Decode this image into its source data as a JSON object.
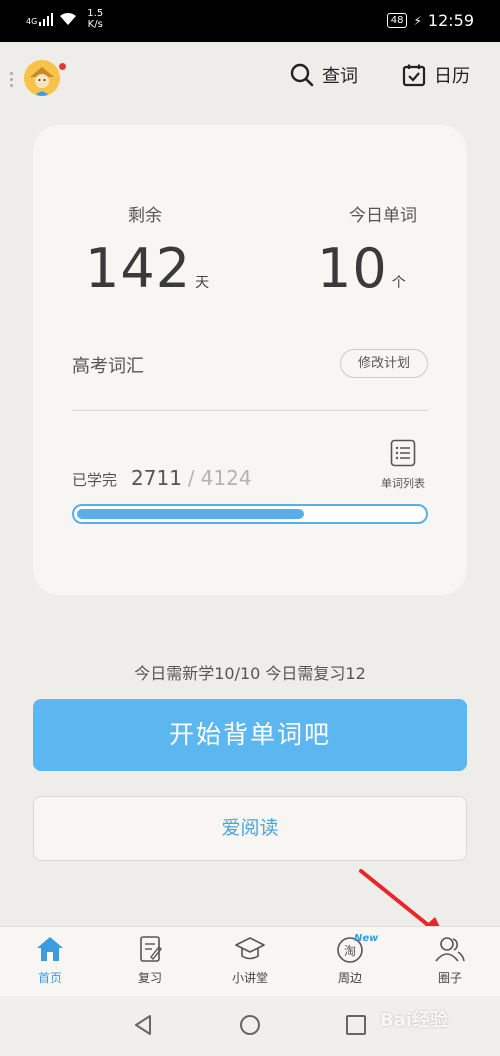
{
  "status_bar": {
    "network": "4G",
    "speed_value": "1.5",
    "speed_unit": "K/s",
    "battery": "48",
    "time": "12:59"
  },
  "header": {
    "search_label": "查词",
    "calendar_label": "日历"
  },
  "card": {
    "remaining_label": "剩余",
    "remaining_value": "142",
    "remaining_unit": "天",
    "today_words_label": "今日单词",
    "today_words_value": "10",
    "today_words_unit": "个",
    "plan_name": "高考词汇",
    "edit_plan_label": "修改计划",
    "learned_label": "已学完",
    "learned_count": "2711",
    "learned_separator": "/",
    "total_count": "4124",
    "word_list_label": "单词列表",
    "progress_fraction": 0.657
  },
  "summary": "今日需新学10/10  今日需复习12",
  "start_button_label": "开始背单词吧",
  "read_button_label": "爱阅读",
  "tabs": [
    {
      "label": "首页",
      "icon": "home-icon",
      "active": true
    },
    {
      "label": "复习",
      "icon": "review-icon",
      "active": false
    },
    {
      "label": "小讲堂",
      "icon": "graduation-cap-icon",
      "active": false
    },
    {
      "label": "周边",
      "icon": "taobao-icon",
      "badge": "New",
      "badge_char": "淘",
      "active": false
    },
    {
      "label": "圈子",
      "icon": "group-icon",
      "active": false
    }
  ],
  "colors": {
    "accent": "#5cb6ef",
    "tab_active": "#3d9be0",
    "arrow": "#e8262b"
  },
  "watermark": "Bai经验"
}
